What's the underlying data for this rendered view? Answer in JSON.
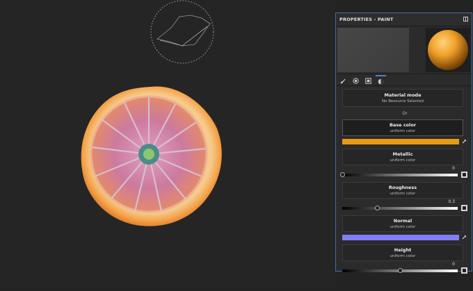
{
  "panel": {
    "title": "PROPERTIES - PAINT",
    "tabs": [
      {
        "icon": "brush-icon"
      },
      {
        "icon": "alpha-circle-icon"
      },
      {
        "icon": "stencil-square-icon"
      },
      {
        "icon": "material-sphere-icon",
        "active": true
      }
    ],
    "material_mode": {
      "label": "Material mode",
      "value": "No Resource Selected"
    },
    "or_label": "Or",
    "channels": {
      "base_color": {
        "label": "Base color",
        "sub": "uniform color",
        "color": "#e89b14"
      },
      "metallic": {
        "label": "Metallic",
        "sub": "uniform color",
        "value": "0",
        "level": 0
      },
      "roughness": {
        "label": "Roughness",
        "sub": "uniform color",
        "value": "0.3",
        "level": 0.3
      },
      "normal": {
        "label": "Normal",
        "sub": "uniform color",
        "color": "#7f7ff7"
      },
      "height": {
        "label": "Height",
        "sub": "uniform color",
        "value": "0",
        "level": 0.5
      }
    }
  }
}
